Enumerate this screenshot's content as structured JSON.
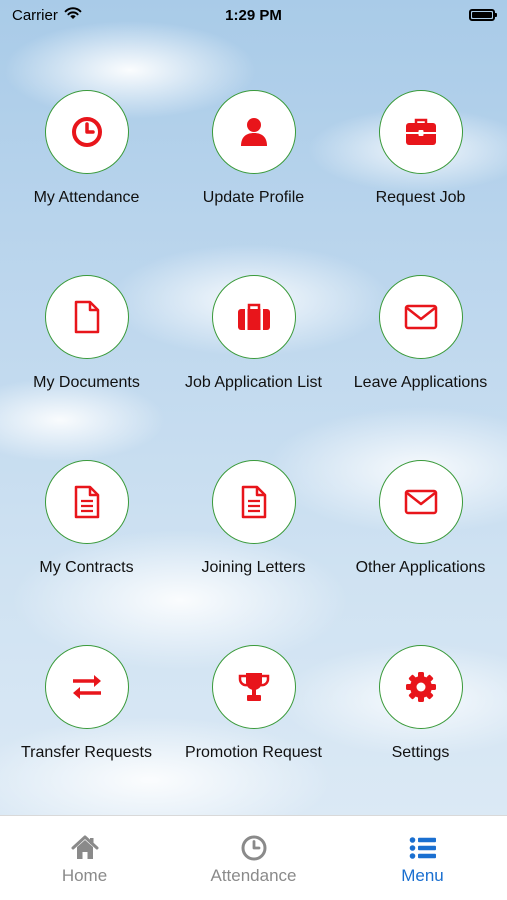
{
  "status_bar": {
    "carrier": "Carrier",
    "time": "1:29 PM"
  },
  "menu": {
    "items": [
      {
        "label": "My Attendance",
        "icon": "clock-icon"
      },
      {
        "label": "Update Profile",
        "icon": "user-icon"
      },
      {
        "label": "Request Job",
        "icon": "briefcase-icon"
      },
      {
        "label": "My Documents",
        "icon": "document-icon"
      },
      {
        "label": "Job Application List",
        "icon": "suitcase-icon"
      },
      {
        "label": "Leave Applications",
        "icon": "envelope-icon"
      },
      {
        "label": "My Contracts",
        "icon": "file-text-icon"
      },
      {
        "label": "Joining Letters",
        "icon": "file-text-icon"
      },
      {
        "label": "Other Applications",
        "icon": "envelope-icon"
      },
      {
        "label": "Transfer Requests",
        "icon": "exchange-icon"
      },
      {
        "label": "Promotion Request",
        "icon": "trophy-icon"
      },
      {
        "label": "Settings",
        "icon": "gear-icon"
      }
    ]
  },
  "tabbar": {
    "tabs": [
      {
        "label": "Home",
        "icon": "home-icon",
        "active": false
      },
      {
        "label": "Attendance",
        "icon": "clock-icon",
        "active": false
      },
      {
        "label": "Menu",
        "icon": "list-icon",
        "active": true
      }
    ]
  },
  "colors": {
    "icon_red": "#e8151b",
    "circle_border": "#3a9a3a",
    "tab_active": "#1a6fd0",
    "tab_inactive": "#8a8a8a"
  }
}
